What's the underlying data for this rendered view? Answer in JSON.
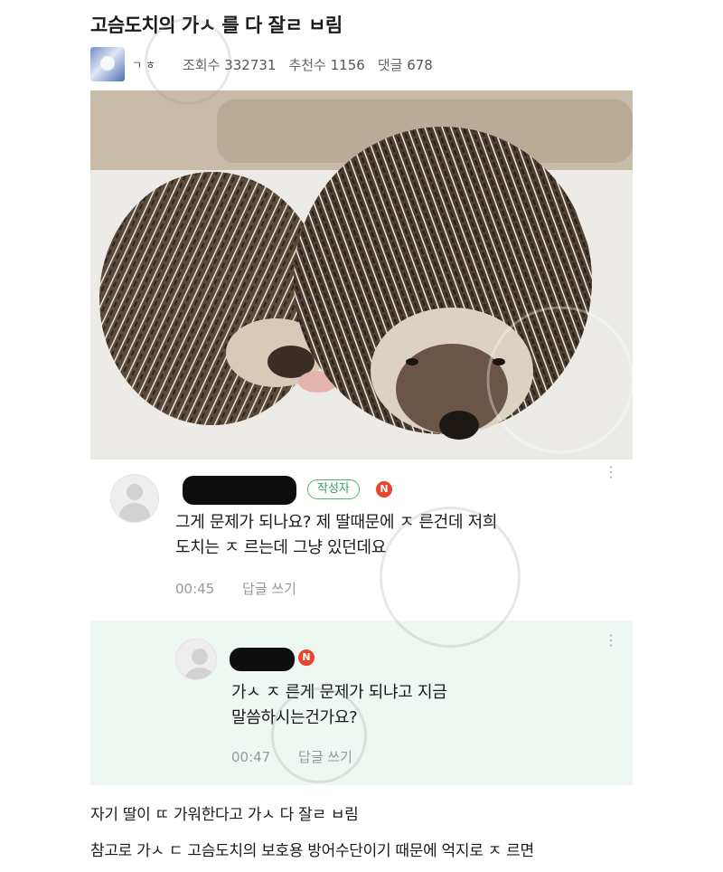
{
  "post": {
    "title": "고슴도치의 가ㅅ 를 다 잘ㄹ ㅂ림",
    "author": "ㄱ ㅎ",
    "views_label": "조회수",
    "views": "332731",
    "recommend_label": "추천수",
    "recommend": "1156",
    "comments_label": "댓글",
    "comments": "678"
  },
  "comments": [
    {
      "author_badge": "작성자",
      "n_badge": "N",
      "lines": [
        "그게 문제가 되나요? 제 딸때문에 ㅈ 른건데 저희",
        "도치는 ㅈ 르는데 그냥 있던데요"
      ],
      "time": "00:45",
      "reply_label": "답글 쓰기"
    },
    {
      "n_badge": "N",
      "lines": [
        "가ㅅ  ㅈ 른게 문제가 되냐고 지금",
        "말씀하시는건가요?"
      ],
      "time": "00:47",
      "reply_label": "답글 쓰기"
    }
  ],
  "body": {
    "line1": "자기 딸이 ㄸ  가워한다고 가ㅅ  다 잘ㄹ ㅂ림",
    "line2": "참고로 가ㅅ  ㄷ 고슴도치의 보호용 방어수단이기 때문에 억지로 ㅈ 르면"
  },
  "colors": {
    "author_badge": "#49b96e",
    "n_badge": "#e8452c",
    "reply_bg": "#eef7f1"
  }
}
